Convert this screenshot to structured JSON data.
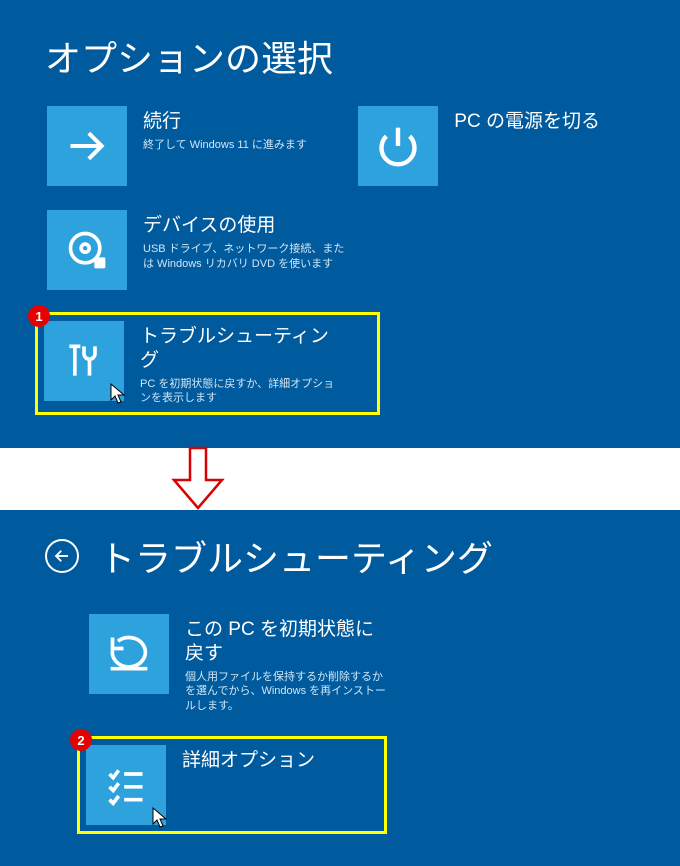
{
  "screen1": {
    "title": "オプションの選択",
    "tiles": {
      "continue": {
        "title": "続行",
        "desc": "終了して Windows 11 に進みます"
      },
      "shutdown": {
        "title": "PC の電源を切る"
      },
      "device": {
        "title": "デバイスの使用",
        "desc": "USB ドライブ、ネットワーク接続、または Windows リカバリ DVD を使います"
      },
      "troubleshoot": {
        "title": "トラブルシューティング",
        "desc": "PC を初期状態に戻すか、詳細オプションを表示します"
      }
    },
    "callout": "1"
  },
  "screen2": {
    "title": "トラブルシューティング",
    "tiles": {
      "reset": {
        "title": "この PC を初期状態に戻す",
        "desc": "個人用ファイルを保持するか削除するかを選んでから、Windows を再インストールします。"
      },
      "advanced": {
        "title": "詳細オプション"
      }
    },
    "callout": "2"
  }
}
